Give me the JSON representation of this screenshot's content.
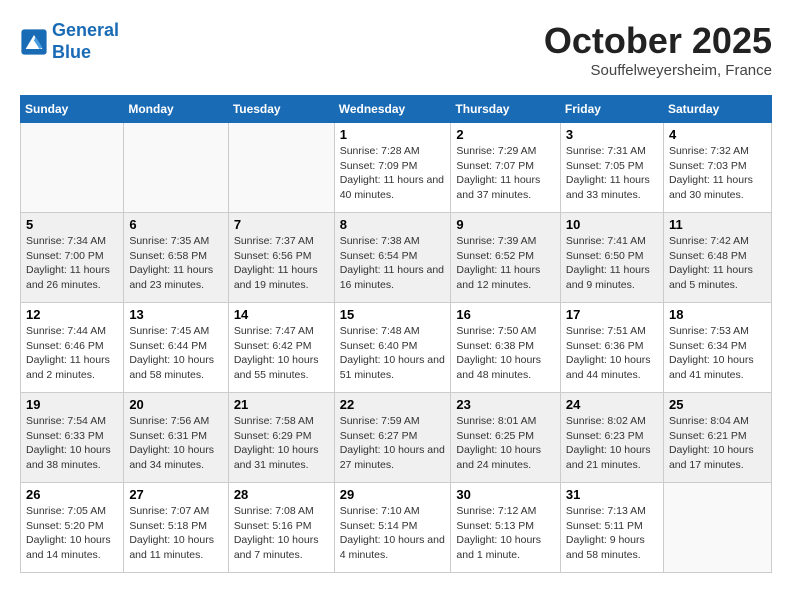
{
  "header": {
    "logo_line1": "General",
    "logo_line2": "Blue",
    "month": "October 2025",
    "location": "Souffelweyersheim, France"
  },
  "days_of_week": [
    "Sunday",
    "Monday",
    "Tuesday",
    "Wednesday",
    "Thursday",
    "Friday",
    "Saturday"
  ],
  "weeks": [
    [
      {
        "day": "",
        "info": ""
      },
      {
        "day": "",
        "info": ""
      },
      {
        "day": "",
        "info": ""
      },
      {
        "day": "1",
        "info": "Sunrise: 7:28 AM\nSunset: 7:09 PM\nDaylight: 11 hours and 40 minutes."
      },
      {
        "day": "2",
        "info": "Sunrise: 7:29 AM\nSunset: 7:07 PM\nDaylight: 11 hours and 37 minutes."
      },
      {
        "day": "3",
        "info": "Sunrise: 7:31 AM\nSunset: 7:05 PM\nDaylight: 11 hours and 33 minutes."
      },
      {
        "day": "4",
        "info": "Sunrise: 7:32 AM\nSunset: 7:03 PM\nDaylight: 11 hours and 30 minutes."
      }
    ],
    [
      {
        "day": "5",
        "info": "Sunrise: 7:34 AM\nSunset: 7:00 PM\nDaylight: 11 hours and 26 minutes."
      },
      {
        "day": "6",
        "info": "Sunrise: 7:35 AM\nSunset: 6:58 PM\nDaylight: 11 hours and 23 minutes."
      },
      {
        "day": "7",
        "info": "Sunrise: 7:37 AM\nSunset: 6:56 PM\nDaylight: 11 hours and 19 minutes."
      },
      {
        "day": "8",
        "info": "Sunrise: 7:38 AM\nSunset: 6:54 PM\nDaylight: 11 hours and 16 minutes."
      },
      {
        "day": "9",
        "info": "Sunrise: 7:39 AM\nSunset: 6:52 PM\nDaylight: 11 hours and 12 minutes."
      },
      {
        "day": "10",
        "info": "Sunrise: 7:41 AM\nSunset: 6:50 PM\nDaylight: 11 hours and 9 minutes."
      },
      {
        "day": "11",
        "info": "Sunrise: 7:42 AM\nSunset: 6:48 PM\nDaylight: 11 hours and 5 minutes."
      }
    ],
    [
      {
        "day": "12",
        "info": "Sunrise: 7:44 AM\nSunset: 6:46 PM\nDaylight: 11 hours and 2 minutes."
      },
      {
        "day": "13",
        "info": "Sunrise: 7:45 AM\nSunset: 6:44 PM\nDaylight: 10 hours and 58 minutes."
      },
      {
        "day": "14",
        "info": "Sunrise: 7:47 AM\nSunset: 6:42 PM\nDaylight: 10 hours and 55 minutes."
      },
      {
        "day": "15",
        "info": "Sunrise: 7:48 AM\nSunset: 6:40 PM\nDaylight: 10 hours and 51 minutes."
      },
      {
        "day": "16",
        "info": "Sunrise: 7:50 AM\nSunset: 6:38 PM\nDaylight: 10 hours and 48 minutes."
      },
      {
        "day": "17",
        "info": "Sunrise: 7:51 AM\nSunset: 6:36 PM\nDaylight: 10 hours and 44 minutes."
      },
      {
        "day": "18",
        "info": "Sunrise: 7:53 AM\nSunset: 6:34 PM\nDaylight: 10 hours and 41 minutes."
      }
    ],
    [
      {
        "day": "19",
        "info": "Sunrise: 7:54 AM\nSunset: 6:33 PM\nDaylight: 10 hours and 38 minutes."
      },
      {
        "day": "20",
        "info": "Sunrise: 7:56 AM\nSunset: 6:31 PM\nDaylight: 10 hours and 34 minutes."
      },
      {
        "day": "21",
        "info": "Sunrise: 7:58 AM\nSunset: 6:29 PM\nDaylight: 10 hours and 31 minutes."
      },
      {
        "day": "22",
        "info": "Sunrise: 7:59 AM\nSunset: 6:27 PM\nDaylight: 10 hours and 27 minutes."
      },
      {
        "day": "23",
        "info": "Sunrise: 8:01 AM\nSunset: 6:25 PM\nDaylight: 10 hours and 24 minutes."
      },
      {
        "day": "24",
        "info": "Sunrise: 8:02 AM\nSunset: 6:23 PM\nDaylight: 10 hours and 21 minutes."
      },
      {
        "day": "25",
        "info": "Sunrise: 8:04 AM\nSunset: 6:21 PM\nDaylight: 10 hours and 17 minutes."
      }
    ],
    [
      {
        "day": "26",
        "info": "Sunrise: 7:05 AM\nSunset: 5:20 PM\nDaylight: 10 hours and 14 minutes."
      },
      {
        "day": "27",
        "info": "Sunrise: 7:07 AM\nSunset: 5:18 PM\nDaylight: 10 hours and 11 minutes."
      },
      {
        "day": "28",
        "info": "Sunrise: 7:08 AM\nSunset: 5:16 PM\nDaylight: 10 hours and 7 minutes."
      },
      {
        "day": "29",
        "info": "Sunrise: 7:10 AM\nSunset: 5:14 PM\nDaylight: 10 hours and 4 minutes."
      },
      {
        "day": "30",
        "info": "Sunrise: 7:12 AM\nSunset: 5:13 PM\nDaylight: 10 hours and 1 minute."
      },
      {
        "day": "31",
        "info": "Sunrise: 7:13 AM\nSunset: 5:11 PM\nDaylight: 9 hours and 58 minutes."
      },
      {
        "day": "",
        "info": ""
      }
    ]
  ]
}
